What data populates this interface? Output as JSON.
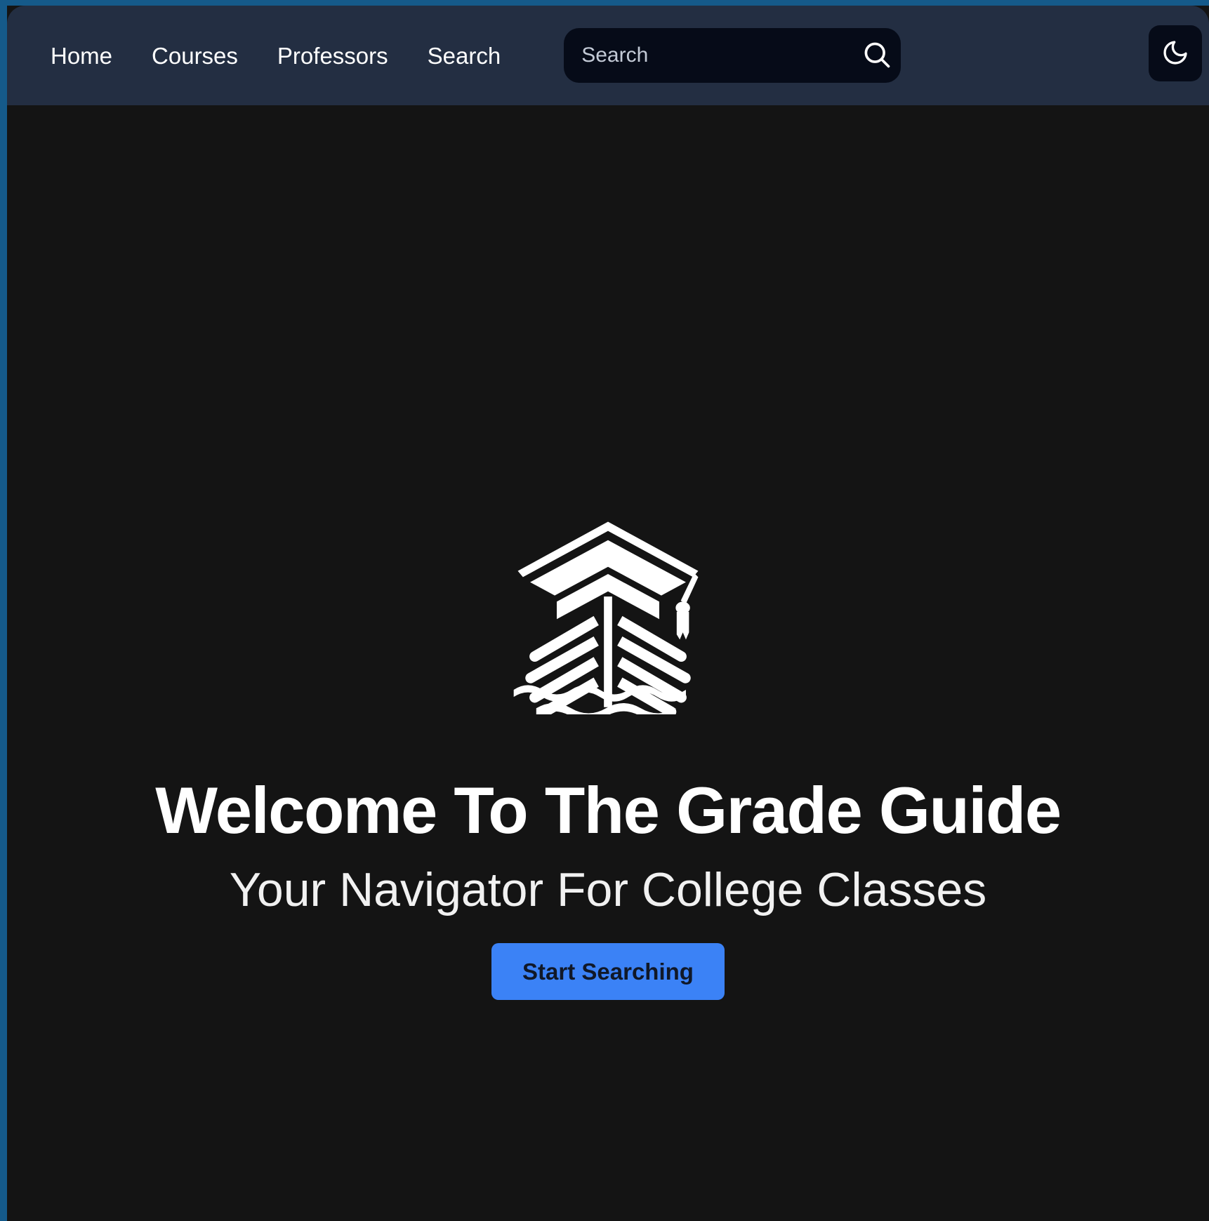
{
  "theme": {
    "frame_color": "#155a8a",
    "navbar_bg": "#232e42",
    "page_bg": "#141414",
    "accent_color": "#3b82f6",
    "field_bg": "#060b18"
  },
  "navbar": {
    "links": [
      {
        "label": "Home",
        "name": "nav-link-home"
      },
      {
        "label": "Courses",
        "name": "nav-link-courses"
      },
      {
        "label": "Professors",
        "name": "nav-link-professors"
      },
      {
        "label": "Search",
        "name": "nav-link-search"
      }
    ],
    "search": {
      "value": "",
      "placeholder": "Search",
      "icon": "search-icon"
    },
    "theme_toggle": {
      "icon": "moon-icon",
      "label": "Toggle dark mode"
    }
  },
  "hero": {
    "logo": {
      "icon": "graduation-ship-logo",
      "alt": "Grade Guide logo: ship bow with graduation cap and waves"
    },
    "title": "Welcome To The Grade Guide",
    "subtitle": "Your Navigator For College Classes",
    "cta_label": "Start Searching"
  }
}
